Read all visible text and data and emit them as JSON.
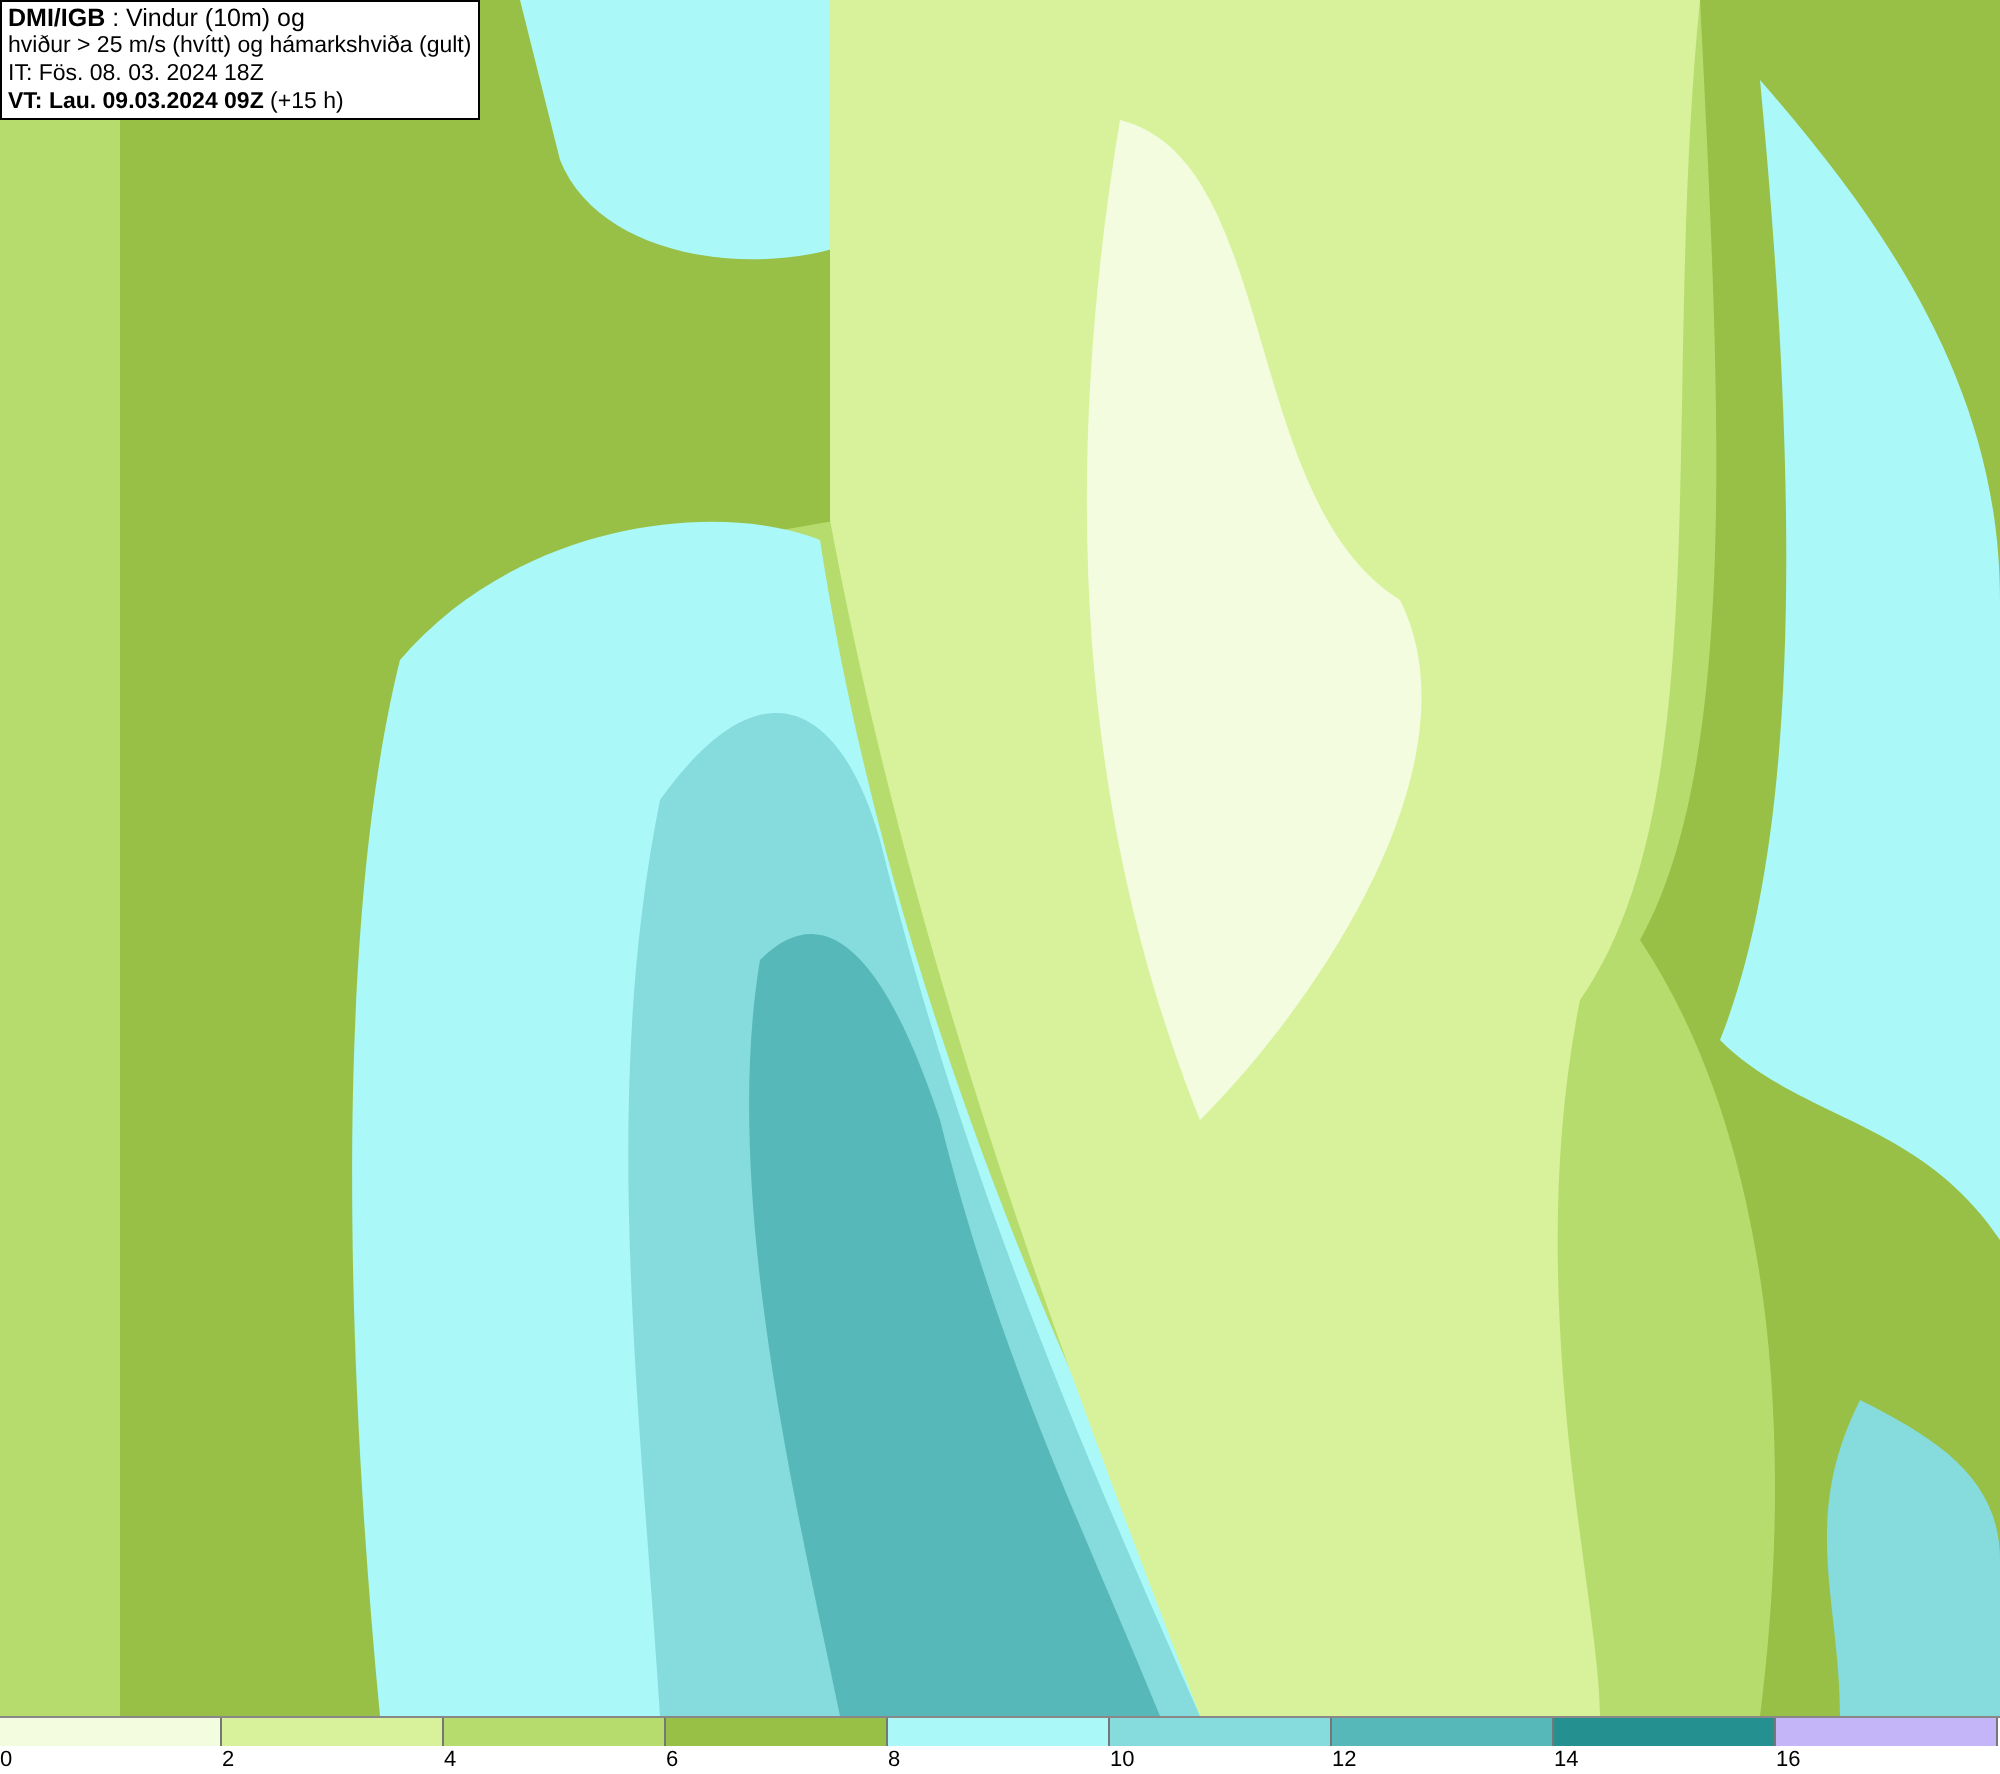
{
  "header": {
    "lines": [
      "**DMI/IGB** : Vindur (10m) og",
      "hviður > 25 m/s (hvítt) og hámarkshviða (gult)",
      "IT: Fös. 08. 03. 2024 18Z",
      "**VT: Lau. 09.03.2024 09Z** (+15 h)"
    ]
  },
  "legend": {
    "segments": [
      {
        "color": "#f4fce0"
      },
      {
        "color": "#d8f29c"
      },
      {
        "color": "#b7dc6e"
      },
      {
        "color": "#98c046"
      },
      {
        "color": "#aaf8f8"
      },
      {
        "color": "#86dcdc"
      },
      {
        "color": "#56b8b8"
      },
      {
        "color": "#249090"
      },
      {
        "color": "#c4b4f8"
      }
    ],
    "ticks": [
      "0",
      "2",
      "4",
      "6",
      "8",
      "10",
      "12",
      "14",
      "16"
    ]
  }
}
